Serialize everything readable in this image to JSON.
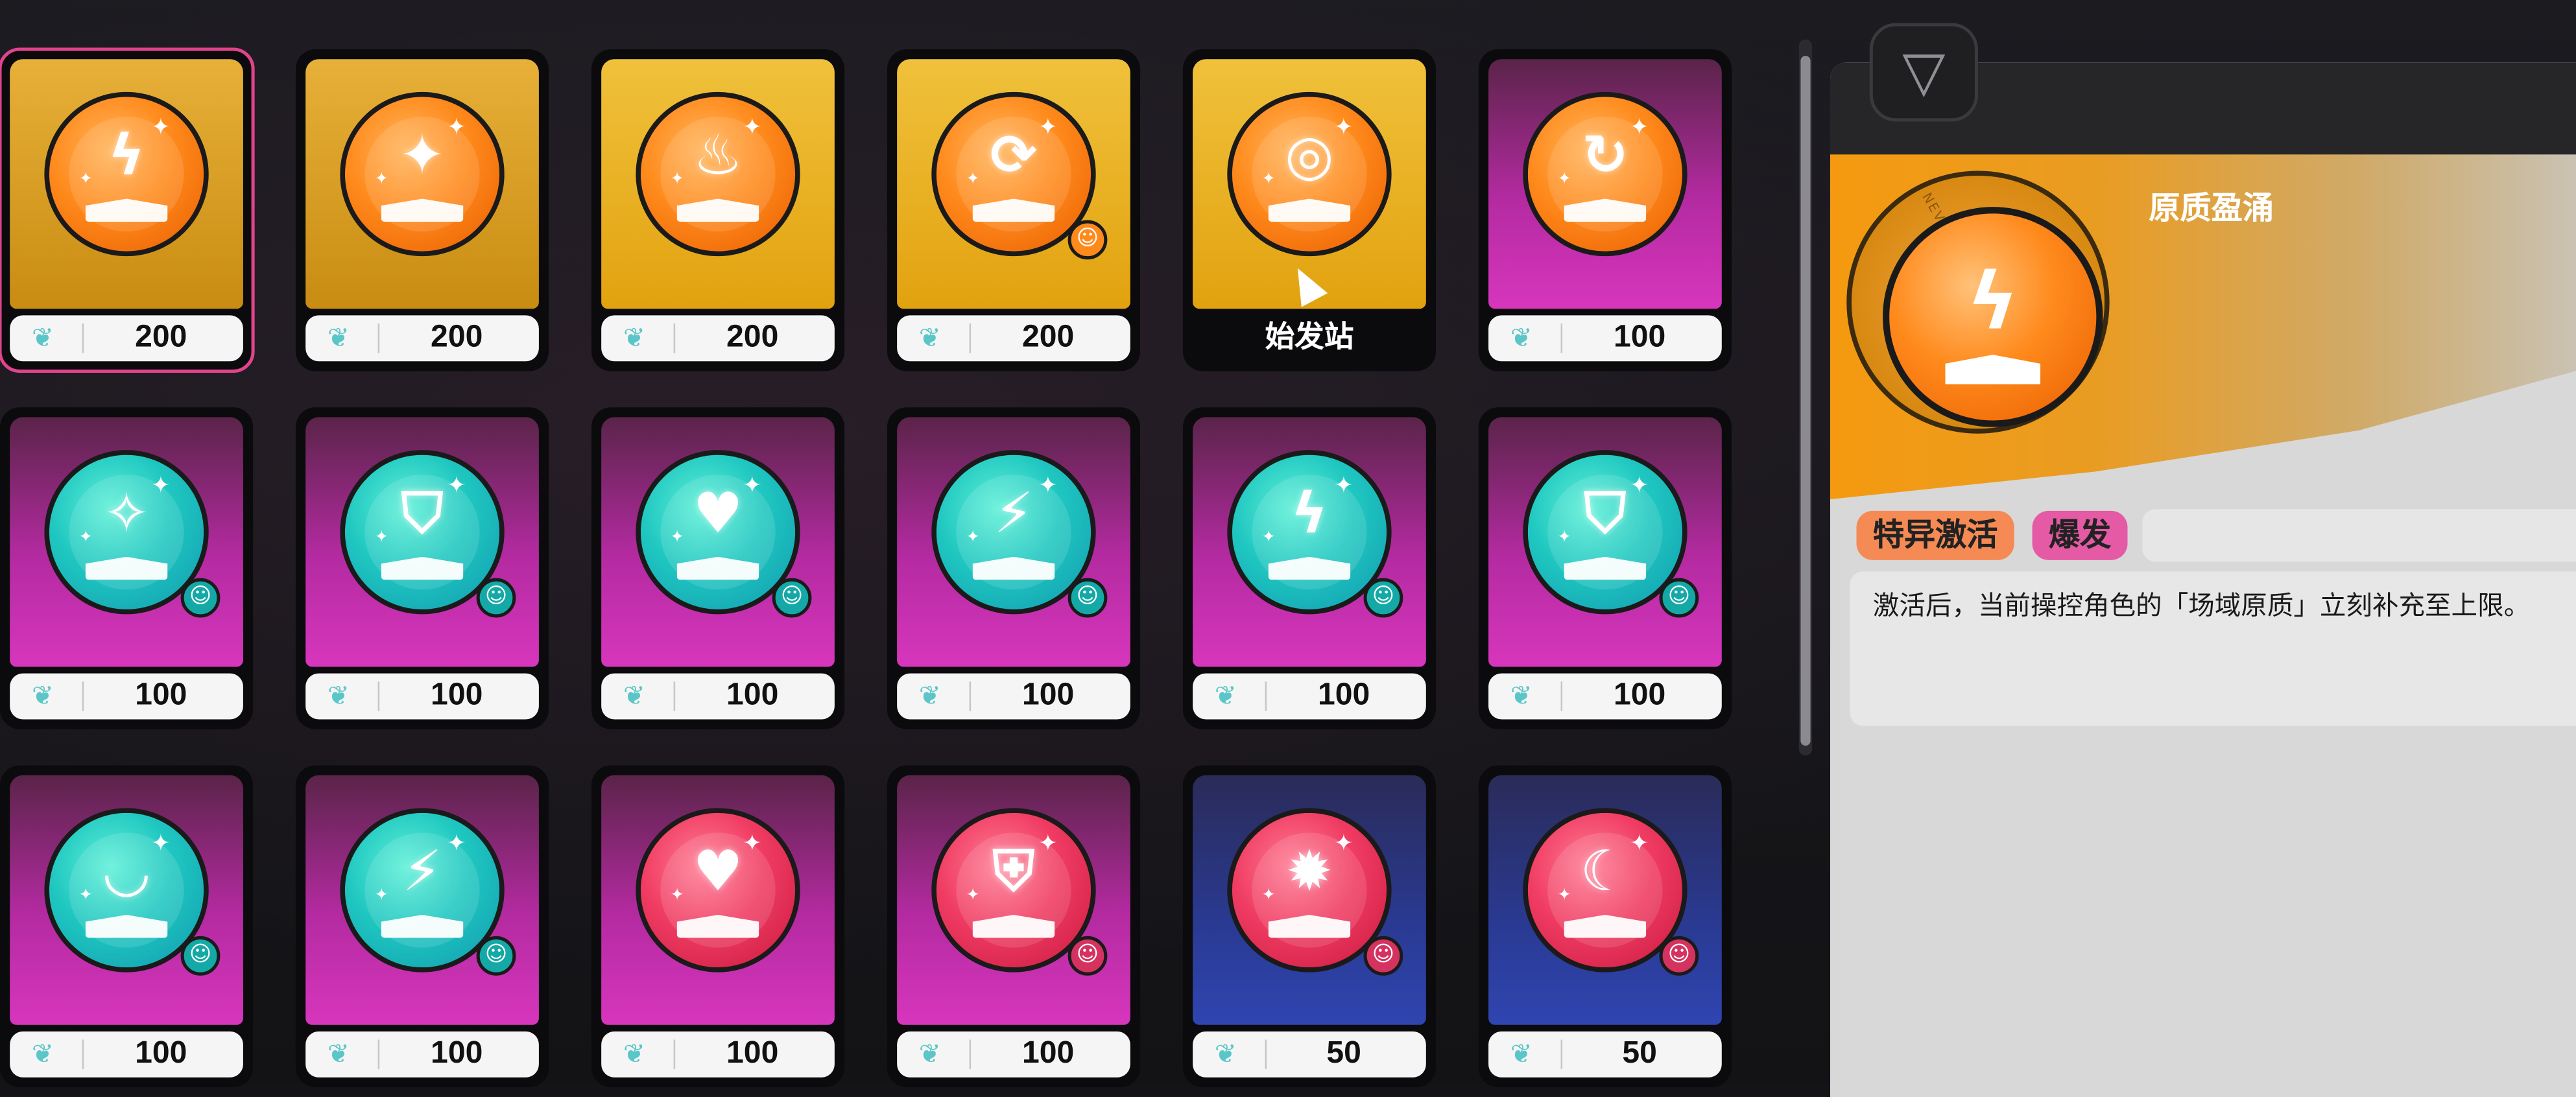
{
  "shop": {
    "start_station_label": "始发站",
    "items": [
      {
        "bg": "bg-gold",
        "coin": "orange",
        "glyph": "ϟ",
        "price": "200",
        "badge": "",
        "selected": true
      },
      {
        "bg": "bg-gold",
        "coin": "orange",
        "glyph": "✦",
        "price": "200",
        "badge": ""
      },
      {
        "bg": "bg-gold2",
        "coin": "orange",
        "glyph": "♨",
        "price": "200",
        "badge": ""
      },
      {
        "bg": "bg-gold2",
        "coin": "orange",
        "glyph": "⟳",
        "price": "200",
        "badge": "b-orange"
      },
      {
        "bg": "bg-gold2",
        "coin": "orange",
        "glyph": "◎",
        "price": "",
        "badge": "",
        "start": true
      },
      {
        "bg": "bg-pink",
        "coin": "orange",
        "glyph": "↻",
        "price": "100",
        "badge": ""
      },
      {
        "bg": "bg-pink",
        "coin": "teal",
        "glyph": "✧",
        "price": "100",
        "badge": "b-teal"
      },
      {
        "bg": "bg-pink",
        "coin": "teal",
        "glyph": "⛉",
        "price": "100",
        "badge": "b-teal"
      },
      {
        "bg": "bg-pink",
        "coin": "teal",
        "glyph": "♥",
        "price": "100",
        "badge": "b-teal"
      },
      {
        "bg": "bg-pink",
        "coin": "teal",
        "glyph": "⚡",
        "price": "100",
        "badge": "b-teal"
      },
      {
        "bg": "bg-pink",
        "coin": "teal",
        "glyph": "ϟ",
        "price": "100",
        "badge": "b-teal"
      },
      {
        "bg": "bg-pink",
        "coin": "teal",
        "glyph": "⛉",
        "price": "100",
        "badge": "b-teal"
      },
      {
        "bg": "bg-pink",
        "coin": "teal",
        "glyph": "◡",
        "price": "100",
        "badge": "b-teal"
      },
      {
        "bg": "bg-pink",
        "coin": "teal",
        "glyph": "⚡",
        "price": "100",
        "badge": "b-teal"
      },
      {
        "bg": "bg-pink",
        "coin": "red",
        "glyph": "♥",
        "price": "100",
        "badge": ""
      },
      {
        "bg": "bg-pink",
        "coin": "red",
        "glyph": "⛨",
        "price": "100",
        "badge": "b-red"
      },
      {
        "bg": "bg-blue",
        "coin": "red",
        "glyph": "✹",
        "price": "50",
        "badge": "b-red"
      },
      {
        "bg": "bg-blue",
        "coin": "red",
        "glyph": "☾",
        "price": "50",
        "badge": "b-red"
      }
    ]
  },
  "detail": {
    "title": "原质盈涌",
    "ring_text": "NEVERNESS TO EVERNESS",
    "tags": [
      "特异激活",
      "爆发"
    ],
    "description": "激活后，当前操控角色的「场域原质」立刻补充至上限。"
  },
  "colors": {
    "selection": "#e0448c",
    "gold": "#e2a20f",
    "pink": "#d736bd",
    "blue": "#2f45b0"
  }
}
